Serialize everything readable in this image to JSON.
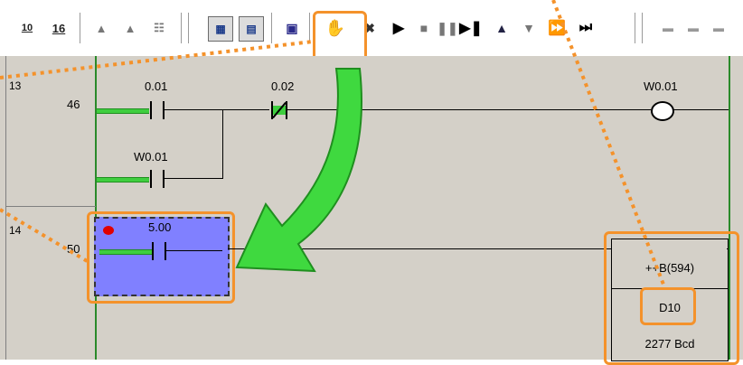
{
  "toolbar": {
    "btn1_label": "10",
    "btn1_sub": "16",
    "btn2_label": "16"
  },
  "rungs": [
    {
      "rung_number": "13",
      "step_number": "46",
      "contacts": [
        "0.01",
        "0.02",
        "W0.01"
      ],
      "coil": "W0.01"
    },
    {
      "rung_number": "14",
      "step_number": "50",
      "contact": "5.00",
      "instruction": "++B(594)",
      "operand": "D10",
      "value": "2277 Bcd"
    }
  ],
  "colors": {
    "ladder_bg": "#d4d0c8",
    "highlight": "#f4922b",
    "selection_fill": "#8080ff",
    "arrow": "#3fd93f",
    "energized": "#3fce3f"
  }
}
